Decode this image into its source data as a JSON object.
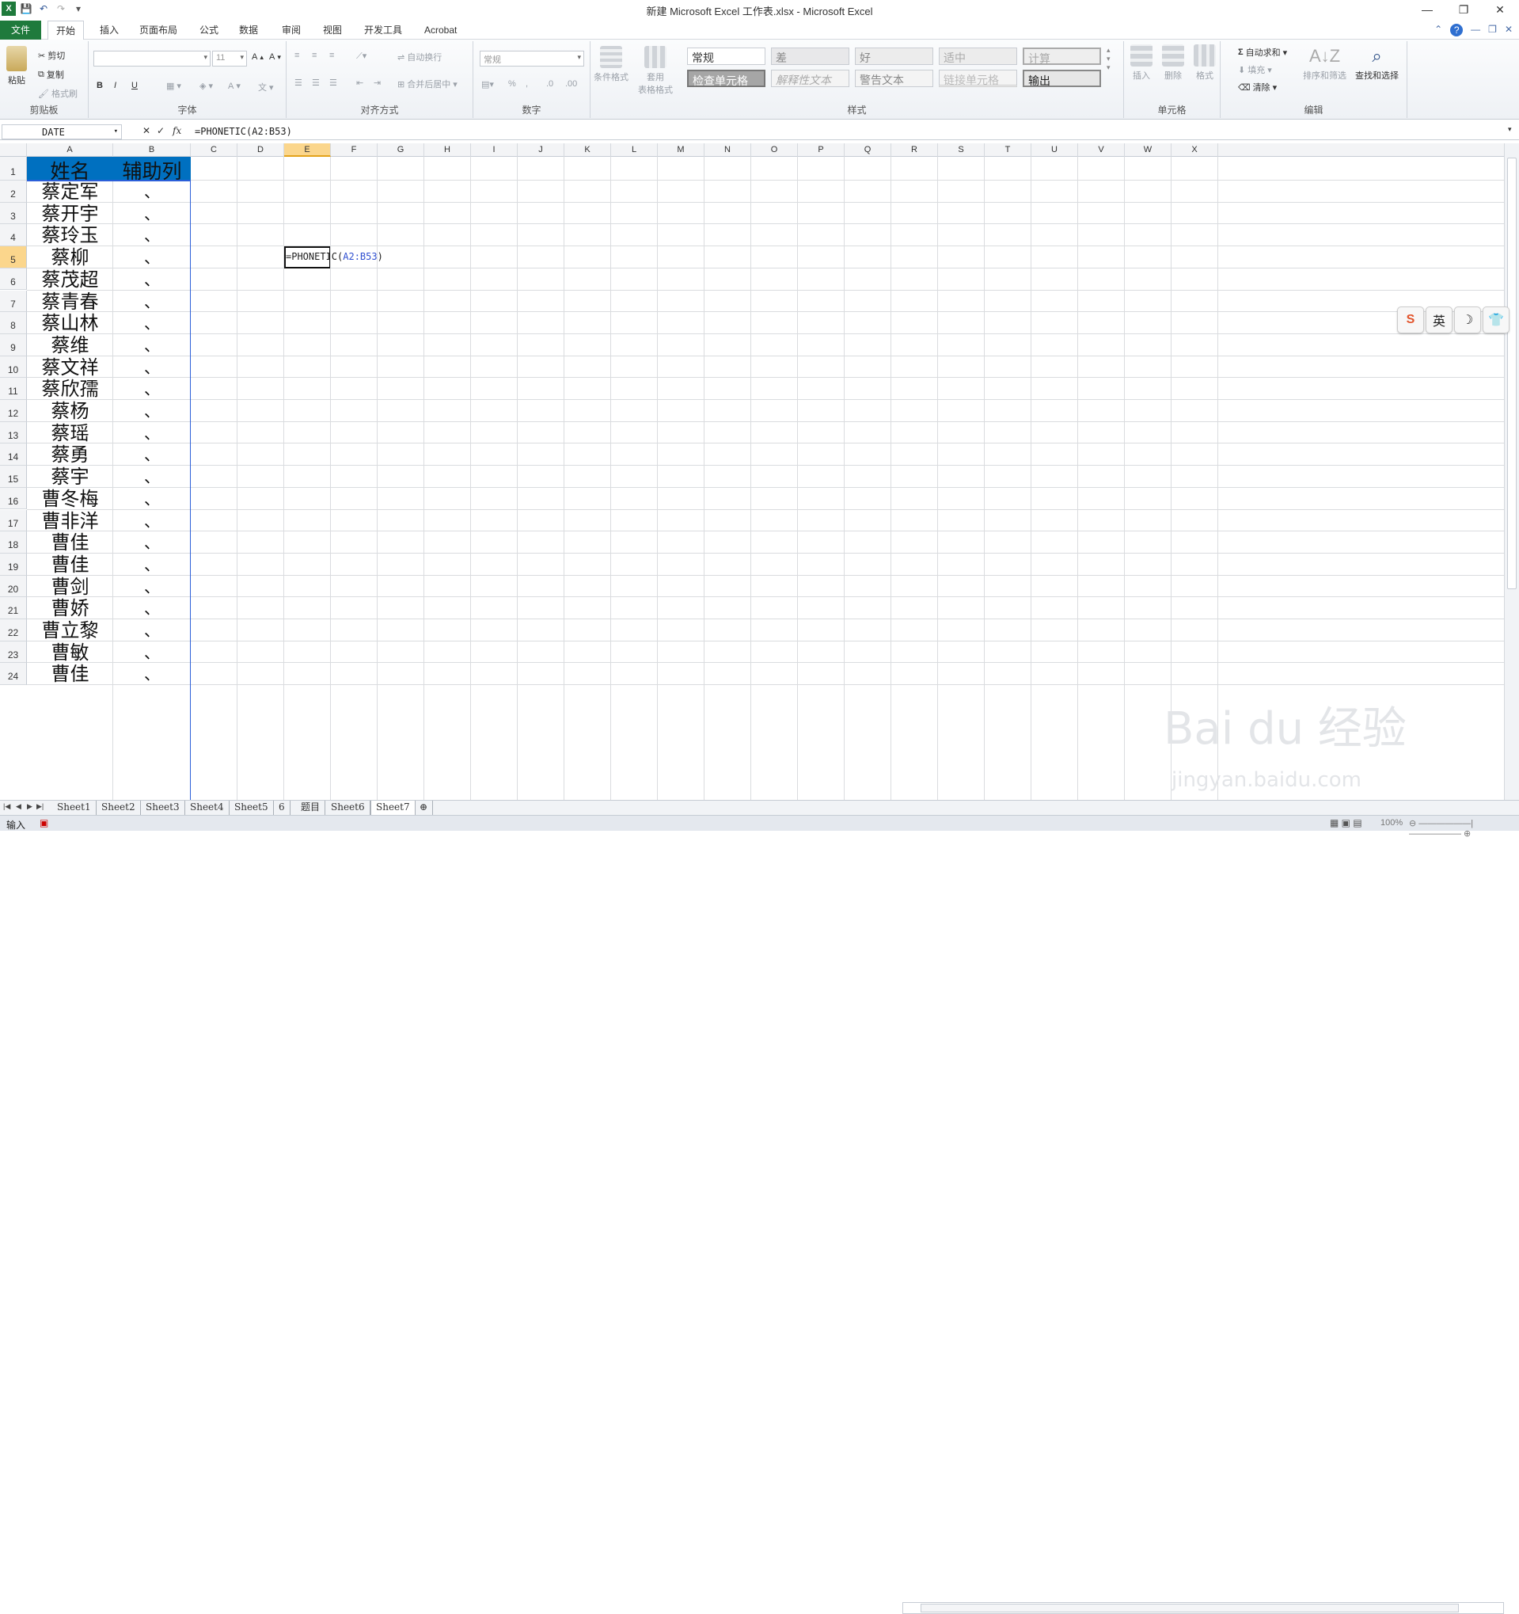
{
  "app": {
    "title": "新建 Microsoft Excel 工作表.xlsx  -  Microsoft Excel",
    "accent": "#1f7a3c"
  },
  "ribbon_tabs": [
    "文件",
    "开始",
    "插入",
    "页面布局",
    "公式",
    "数据",
    "审阅",
    "视图",
    "开发工具",
    "Acrobat"
  ],
  "ribbon": {
    "clipboard": {
      "paste": "粘贴",
      "cut": "剪切",
      "copy": "复制",
      "format_painter": "格式刷",
      "label": "剪贴板"
    },
    "font": {
      "size": "11",
      "label": "字体",
      "bold": "B",
      "italic": "I",
      "underline": "U"
    },
    "alignment": {
      "wrap": "自动换行",
      "merge": "合并后居中",
      "label": "对齐方式"
    },
    "number": {
      "format": "常规",
      "label": "数字"
    },
    "styles": {
      "conditional": "条件格式",
      "table_format": "套用\n表格格式",
      "cells": [
        "常规",
        "差",
        "好",
        "适中",
        "计算",
        "检查单元格",
        "解释性文本",
        "警告文本",
        "链接单元格",
        "输出"
      ],
      "label": "样式"
    },
    "cells": {
      "insert": "插入",
      "delete": "删除",
      "format": "格式",
      "label": "单元格"
    },
    "editing": {
      "autosum": "自动求和",
      "fill": "填充",
      "clear": "清除",
      "sort": "排序和筛选",
      "find": "查找和选择",
      "label": "编辑"
    }
  },
  "formula_bar": {
    "name_box": "DATE",
    "formula": "=PHONETIC(A2:B53)"
  },
  "columns": [
    "A",
    "B",
    "C",
    "D",
    "E",
    "F",
    "G",
    "H",
    "I",
    "J",
    "K",
    "L",
    "M",
    "N",
    "O",
    "P",
    "Q",
    "R",
    "S",
    "T",
    "U",
    "V",
    "W",
    "X"
  ],
  "selected_column": "E",
  "rows": [
    1,
    2,
    3,
    4,
    5,
    6,
    7,
    8,
    9,
    10,
    11,
    12,
    13,
    14,
    15,
    16,
    17,
    18,
    19,
    20,
    21,
    22,
    23,
    24
  ],
  "selected_row": 5,
  "table": {
    "headers": [
      "姓名",
      "辅助列"
    ],
    "header_color": "#0070c0",
    "names": [
      "蔡定军",
      "蔡开宇",
      "蔡玲玉",
      "蔡柳",
      "蔡茂超",
      "蔡青春",
      "蔡山林",
      "蔡维",
      "蔡文祥",
      "蔡欣孺",
      "蔡杨",
      "蔡瑶",
      "蔡勇",
      "蔡宇",
      "曹冬梅",
      "曹非洋",
      "曹佳",
      "曹佳",
      "曹剑",
      "曹娇",
      "曹立黎",
      "曹敏",
      "曹佳"
    ],
    "helper": "、"
  },
  "active_cell": {
    "ref": "E5",
    "editor_prefix": "=PHONETIC(",
    "editor_range": "A2:B53",
    "editor_suffix": ")"
  },
  "sheets": [
    "Sheet1",
    "Sheet2",
    "Sheet3",
    "Sheet4",
    "Sheet5",
    "6",
    "题目",
    "Sheet6",
    "Sheet7"
  ],
  "active_sheet": "Sheet7",
  "status": {
    "mode": "输入",
    "zoom": "100%"
  },
  "ime": [
    "S",
    "英",
    "☽",
    "👕"
  ],
  "watermark": {
    "main": "Bai du 经验",
    "sub": "jingyan.baidu.com"
  }
}
